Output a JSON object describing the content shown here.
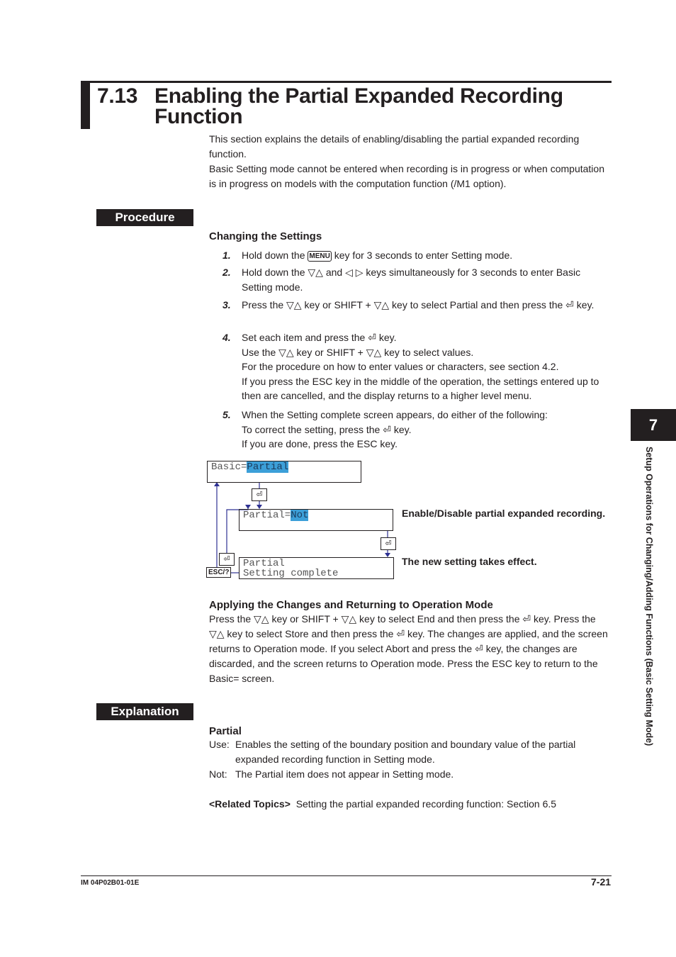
{
  "header": {
    "section_number": "7.13",
    "title_line1": "Enabling the Partial Expanded Recording",
    "title_line2": "Function"
  },
  "intro": {
    "p1": "This section explains the details of enabling/disabling the partial expanded recording function.",
    "p2": "Basic Setting mode cannot be entered when recording is in progress or when computation is in progress on models with the computation function (/M1 option)."
  },
  "procedure": {
    "label": "Procedure",
    "subhead": "Changing the Settings",
    "steps": [
      {
        "n": "1.",
        "parts": [
          "Hold down the ",
          "[MENU]",
          " key for 3 seconds to enter Setting mode."
        ]
      },
      {
        "n": "2.",
        "text": "Hold down the ▽△ and ◁ ▷ keys simultaneously for 3 seconds to enter Basic Setting mode."
      },
      {
        "n": "3.",
        "text": "Press the ▽△ key or SHIFT + ▽△ key to select Partial and then press the ⏎ key."
      },
      {
        "n": "4.",
        "lines": [
          "Set each item and press the ⏎ key.",
          "Use the ▽△ key or SHIFT + ▽△ key to select values.",
          "For the procedure on how to enter values or characters, see section 4.2.",
          "If you press the ESC key in the middle of the operation, the settings entered up to then are cancelled, and the display returns to a higher level menu."
        ]
      },
      {
        "n": "5.",
        "lines": [
          "When the Setting complete screen appears, do either of the following:",
          "To correct the setting, press the ⏎ key.",
          "If you are done, press the ESC key."
        ]
      }
    ],
    "menu_key": "MENU"
  },
  "diagram": {
    "screen1_prefix": "Basic=",
    "screen1_value": "Partial",
    "screen2_prefix": "Partial=",
    "screen2_value": "Not",
    "screen3_line1": "Partial",
    "screen3_line2": "Setting complete",
    "enter_key": "⏎",
    "esc_key": "ESC/?",
    "caption1": "Enable/Disable partial expanded recording.",
    "caption2": "The new setting takes effect."
  },
  "applying": {
    "subhead": "Applying the Changes and Returning to Operation Mode",
    "text": "Press the ▽△ key or SHIFT + ▽△ key to select End and then press the ⏎ key. Press the ▽△ key to select Store and then press the ⏎ key. The changes are applied, and the screen returns to Operation mode. If you select Abort and press the ⏎ key, the changes are discarded, and the screen returns to Operation mode. Press the ESC key to return to the Basic= screen."
  },
  "explanation": {
    "label": "Explanation",
    "subhead": "Partial",
    "use_term": "Use:",
    "use_text": "Enables the setting of the boundary position and boundary value of the partial expanded recording function in Setting mode.",
    "not_term": "Not:",
    "not_text": "The Partial item does not appear in Setting mode.",
    "related_label": "<Related Topics>",
    "related_text": "Setting the partial expanded recording function: Section 6.5"
  },
  "side_tab": {
    "chapter": "7",
    "title": "Setup Operations for Changing/Adding Functions (Basic Setting Mode)"
  },
  "footer": {
    "doc_id": "IM 04P02B01-01E",
    "page": "7-21"
  }
}
